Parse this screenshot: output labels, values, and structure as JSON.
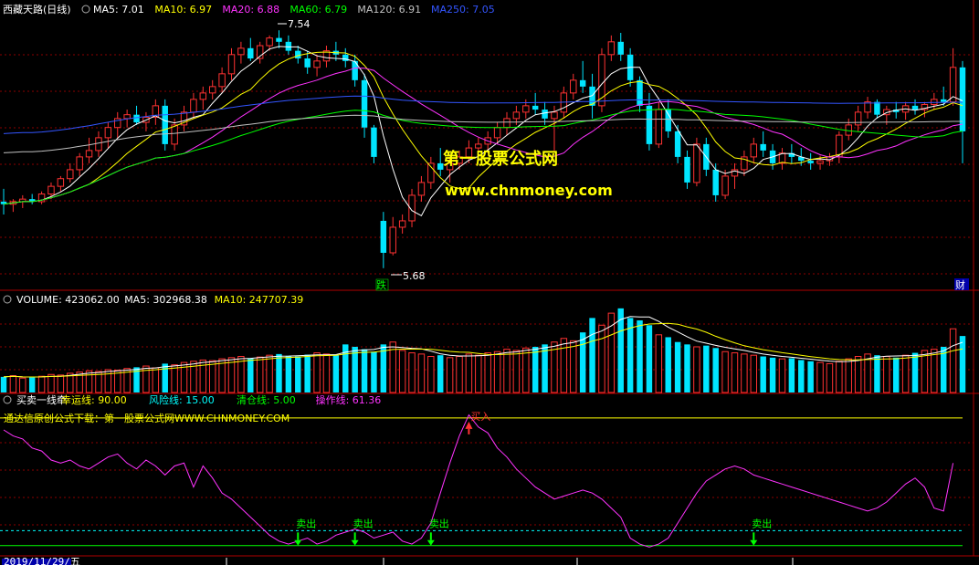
{
  "title": {
    "name": "西藏天路",
    "period": "(日线)"
  },
  "price_legend": [
    {
      "label": "MA5: 7.01",
      "color": "#ffffff"
    },
    {
      "label": "MA10: 6.97",
      "color": "#ffff00"
    },
    {
      "label": "MA20: 6.88",
      "color": "#ff33ff"
    },
    {
      "label": "MA60: 6.79",
      "color": "#00ff00"
    },
    {
      "label": "MA120: 6.91",
      "color": "#c0c0c0"
    },
    {
      "label": "MA250: 7.05",
      "color": "#3355ff"
    }
  ],
  "annotations": {
    "high": "7.54",
    "low": "5.68",
    "drop_mark": "跌",
    "fin_mark": "财"
  },
  "watermark": {
    "cn": "第一股票公式网",
    "url": "www.chnmoney.com"
  },
  "volume_legend": [
    {
      "label": "VOLUME: 423062.00",
      "color": "#ffffff"
    },
    {
      "label": "MA5: 302968.38",
      "color": "#ffffff"
    },
    {
      "label": "MA10: 247707.39",
      "color": "#ffff00"
    }
  ],
  "indicator_legend": [
    {
      "label": "买卖一线牵",
      "color": "#ffffff"
    },
    {
      "label": "幸运线: 90.00",
      "color": "#ffff00"
    },
    {
      "label": "风险线: 15.00",
      "color": "#00ffff"
    },
    {
      "label": "清仓线: 5.00",
      "color": "#00ff00"
    },
    {
      "label": "操作线: 61.36",
      "color": "#ff33ff"
    }
  ],
  "indicator_note": "通达信原创公式下载：第一股票公式网WWW.CHNMONEY.COM",
  "signals": {
    "sell": "卖出",
    "buy": "买入"
  },
  "date_label": "2019/11/29/五",
  "colors": {
    "up": "#ff3232",
    "down": "#00e5ff",
    "grid": "#8b0000",
    "panel_border": "#b00000",
    "bg": "#000000"
  },
  "chart_data": {
    "type": "candlestick",
    "candles": [
      [
        6.2,
        6.3,
        6.1,
        6.18
      ],
      [
        6.18,
        6.22,
        6.12,
        6.2
      ],
      [
        6.2,
        6.25,
        6.15,
        6.22
      ],
      [
        6.22,
        6.26,
        6.18,
        6.2
      ],
      [
        6.2,
        6.28,
        6.18,
        6.26
      ],
      [
        6.26,
        6.35,
        6.22,
        6.32
      ],
      [
        6.32,
        6.4,
        6.28,
        6.38
      ],
      [
        6.38,
        6.5,
        6.35,
        6.45
      ],
      [
        6.45,
        6.58,
        6.4,
        6.55
      ],
      [
        6.55,
        6.7,
        6.5,
        6.6
      ],
      [
        6.6,
        6.75,
        6.55,
        6.7
      ],
      [
        6.7,
        6.82,
        6.62,
        6.78
      ],
      [
        6.78,
        6.9,
        6.7,
        6.85
      ],
      [
        6.85,
        6.92,
        6.78,
        6.88
      ],
      [
        6.88,
        6.95,
        6.8,
        6.82
      ],
      [
        6.82,
        6.9,
        6.75,
        6.86
      ],
      [
        6.86,
        7.0,
        6.8,
        6.95
      ],
      [
        6.95,
        7.0,
        6.6,
        6.65
      ],
      [
        6.65,
        6.85,
        6.6,
        6.8
      ],
      [
        6.8,
        6.95,
        6.75,
        6.9
      ],
      [
        6.9,
        7.05,
        6.85,
        7.0
      ],
      [
        7.0,
        7.1,
        6.92,
        7.05
      ],
      [
        7.05,
        7.15,
        7.0,
        7.1
      ],
      [
        7.1,
        7.25,
        7.05,
        7.2
      ],
      [
        7.2,
        7.4,
        7.15,
        7.35
      ],
      [
        7.35,
        7.45,
        7.28,
        7.4
      ],
      [
        7.4,
        7.48,
        7.3,
        7.32
      ],
      [
        7.32,
        7.45,
        7.28,
        7.42
      ],
      [
        7.42,
        7.5,
        7.38,
        7.48
      ],
      [
        7.48,
        7.54,
        7.4,
        7.45
      ],
      [
        7.45,
        7.5,
        7.35,
        7.38
      ],
      [
        7.38,
        7.42,
        7.28,
        7.32
      ],
      [
        7.32,
        7.38,
        7.2,
        7.25
      ],
      [
        7.25,
        7.35,
        7.18,
        7.3
      ],
      [
        7.3,
        7.42,
        7.25,
        7.38
      ],
      [
        7.38,
        7.45,
        7.3,
        7.35
      ],
      [
        7.35,
        7.4,
        7.25,
        7.3
      ],
      [
        7.3,
        7.35,
        7.1,
        7.15
      ],
      [
        7.15,
        7.2,
        6.7,
        6.78
      ],
      [
        6.78,
        6.8,
        6.5,
        6.55
      ],
      [
        6.05,
        6.12,
        5.68,
        5.8
      ],
      [
        5.8,
        6.08,
        5.78,
        6.0
      ],
      [
        6.0,
        6.1,
        5.95,
        6.05
      ],
      [
        6.05,
        6.3,
        6.0,
        6.25
      ],
      [
        6.25,
        6.4,
        6.2,
        6.35
      ],
      [
        6.35,
        6.55,
        6.3,
        6.5
      ],
      [
        6.5,
        6.62,
        6.4,
        6.45
      ],
      [
        6.45,
        6.55,
        6.35,
        6.5
      ],
      [
        6.5,
        6.6,
        6.45,
        6.55
      ],
      [
        6.55,
        6.68,
        6.5,
        6.62
      ],
      [
        6.62,
        6.7,
        6.55,
        6.65
      ],
      [
        6.65,
        6.75,
        6.58,
        6.7
      ],
      [
        6.7,
        6.82,
        6.65,
        6.78
      ],
      [
        6.78,
        6.9,
        6.72,
        6.85
      ],
      [
        6.85,
        6.95,
        6.8,
        6.9
      ],
      [
        6.9,
        7.0,
        6.85,
        6.95
      ],
      [
        6.95,
        7.05,
        6.88,
        6.92
      ],
      [
        6.92,
        6.98,
        6.8,
        6.85
      ],
      [
        6.85,
        6.95,
        6.6,
        6.9
      ],
      [
        6.9,
        7.1,
        6.85,
        7.05
      ],
      [
        7.05,
        7.2,
        7.0,
        7.15
      ],
      [
        7.15,
        7.3,
        7.05,
        7.1
      ],
      [
        7.1,
        7.2,
        6.85,
        6.95
      ],
      [
        6.95,
        7.4,
        6.9,
        7.35
      ],
      [
        7.35,
        7.5,
        7.3,
        7.45
      ],
      [
        7.45,
        7.52,
        7.3,
        7.35
      ],
      [
        7.35,
        7.4,
        7.1,
        7.15
      ],
      [
        7.15,
        7.18,
        6.9,
        6.95
      ],
      [
        6.95,
        7.05,
        6.6,
        6.65
      ],
      [
        6.65,
        6.98,
        6.62,
        6.92
      ],
      [
        6.92,
        7.0,
        6.7,
        6.75
      ],
      [
        6.75,
        6.8,
        6.5,
        6.55
      ],
      [
        6.55,
        6.6,
        6.3,
        6.35
      ],
      [
        6.35,
        6.7,
        6.32,
        6.65
      ],
      [
        6.65,
        6.7,
        6.4,
        6.45
      ],
      [
        6.45,
        6.5,
        6.2,
        6.25
      ],
      [
        6.25,
        6.45,
        6.22,
        6.4
      ],
      [
        6.4,
        6.5,
        6.3,
        6.45
      ],
      [
        6.45,
        6.6,
        6.4,
        6.55
      ],
      [
        6.55,
        6.7,
        6.5,
        6.65
      ],
      [
        6.65,
        6.75,
        6.55,
        6.6
      ],
      [
        6.6,
        6.65,
        6.45,
        6.5
      ],
      [
        6.5,
        6.62,
        6.45,
        6.58
      ],
      [
        6.58,
        6.65,
        6.5,
        6.55
      ],
      [
        6.55,
        6.62,
        6.48,
        6.52
      ],
      [
        6.52,
        6.58,
        6.45,
        6.5
      ],
      [
        6.5,
        6.56,
        6.45,
        6.52
      ],
      [
        6.52,
        6.58,
        6.48,
        6.55
      ],
      [
        6.55,
        6.75,
        6.5,
        6.72
      ],
      [
        6.72,
        6.85,
        6.68,
        6.8
      ],
      [
        6.8,
        6.95,
        6.75,
        6.9
      ],
      [
        6.9,
        7.02,
        6.85,
        6.98
      ],
      [
        6.98,
        7.0,
        6.85,
        6.88
      ],
      [
        6.88,
        6.95,
        6.8,
        6.92
      ],
      [
        6.92,
        6.98,
        6.85,
        6.9
      ],
      [
        6.9,
        6.98,
        6.84,
        6.95
      ],
      [
        6.95,
        7.0,
        6.88,
        6.92
      ],
      [
        6.92,
        6.98,
        6.86,
        6.96
      ],
      [
        6.96,
        7.05,
        6.92,
        7.0
      ],
      [
        7.0,
        7.1,
        6.95,
        6.98
      ],
      [
        6.98,
        7.4,
        6.95,
        7.25
      ],
      [
        7.25,
        7.3,
        6.5,
        6.75
      ]
    ],
    "volume": [
      130,
      140,
      120,
      125,
      135,
      150,
      145,
      160,
      170,
      180,
      175,
      190,
      185,
      200,
      210,
      220,
      205,
      240,
      230,
      250,
      260,
      270,
      265,
      280,
      290,
      300,
      285,
      295,
      310,
      320,
      305,
      300,
      315,
      330,
      320,
      310,
      400,
      380,
      360,
      340,
      400,
      420,
      350,
      330,
      320,
      300,
      310,
      290,
      300,
      320,
      310,
      330,
      340,
      360,
      350,
      370,
      380,
      400,
      420,
      450,
      430,
      500,
      620,
      560,
      660,
      700,
      620,
      600,
      560,
      480,
      460,
      420,
      400,
      380,
      390,
      370,
      340,
      330,
      320,
      310,
      300,
      290,
      280,
      285,
      270,
      260,
      250,
      240,
      260,
      280,
      300,
      320,
      310,
      300,
      290,
      310,
      330,
      350,
      360,
      380,
      530,
      470
    ],
    "indicator": [
      82,
      78,
      76,
      70,
      68,
      62,
      60,
      62,
      58,
      56,
      60,
      64,
      66,
      60,
      56,
      62,
      58,
      52,
      58,
      60,
      44,
      58,
      50,
      40,
      36,
      30,
      24,
      18,
      12,
      8,
      6,
      8,
      10,
      6,
      8,
      12,
      14,
      16,
      14,
      10,
      12,
      14,
      8,
      6,
      10,
      20,
      40,
      60,
      78,
      92,
      84,
      80,
      70,
      64,
      56,
      50,
      44,
      40,
      36,
      38,
      40,
      42,
      40,
      36,
      30,
      24,
      10,
      6,
      4,
      6,
      10,
      20,
      30,
      40,
      48,
      52,
      56,
      58,
      56,
      52,
      50,
      48,
      46,
      44,
      42,
      40,
      38,
      36,
      34,
      32,
      30,
      28,
      30,
      34,
      40,
      46,
      50,
      44,
      30,
      28,
      60
    ],
    "levels": {
      "lucky": 90,
      "risk": 15,
      "clear": 5
    },
    "sell_signals": [
      31,
      37,
      45,
      79
    ],
    "buy_signals": [
      49
    ]
  }
}
